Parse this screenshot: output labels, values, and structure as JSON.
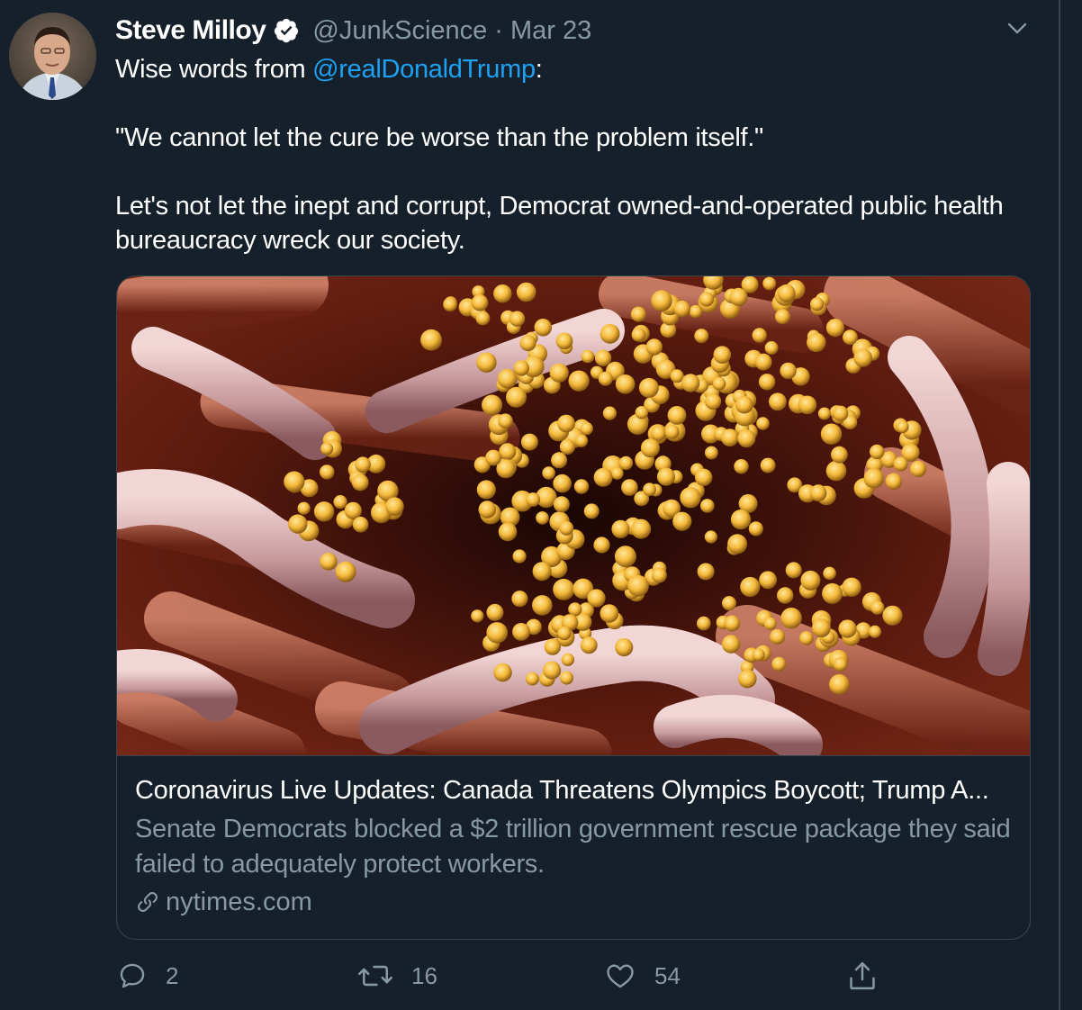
{
  "author": {
    "display_name": "Steve Milloy",
    "handle": "@JunkScience",
    "separator": "·",
    "date": "Mar 23",
    "verified": true
  },
  "tweet": {
    "line1_prefix": "Wise words from ",
    "mention": "@realDonaldTrump",
    "line1_suffix": ":",
    "quote": "\"We cannot let the cure be worse than the problem itself.\"",
    "paragraph": "Let's not let the inept and corrupt, Democrat owned-and-operated public health bureaucracy wreck our society."
  },
  "card": {
    "title": "Coronavirus Live Updates: Canada Threatens Olympics Boycott; Trump A...",
    "description": "Senate Democrats blocked a $2 trillion government rescue package they said failed to adequately protect workers.",
    "domain": "nytimes.com"
  },
  "actions": {
    "replies": "2",
    "retweets": "16",
    "likes": "54"
  },
  "colors": {
    "background": "#15202b",
    "text": "#ffffff",
    "secondary": "#8899a6",
    "link": "#1da1f2",
    "border": "#38444d"
  },
  "icons": [
    "verified-badge-icon",
    "chevron-down-icon",
    "link-icon",
    "reply-icon",
    "retweet-icon",
    "like-icon",
    "share-icon"
  ]
}
